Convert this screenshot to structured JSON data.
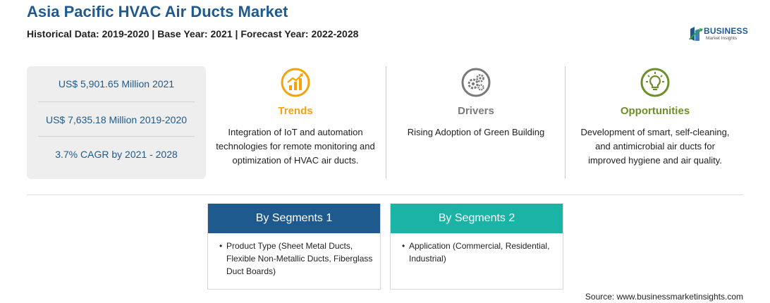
{
  "header": {
    "title": "Asia Pacific HVAC Air Ducts Market",
    "subtitle": "Historical Data: 2019-2020 | Base Year: 2021 | Forecast Year: 2022-2028"
  },
  "logo": {
    "word": "BUSINESS",
    "tagline": "Market Insights"
  },
  "stats": [
    "US$ 5,901.65 Million 2021",
    "US$ 7,635.18 Million 2019-2020",
    "3.7% CAGR by 2021 - 2028"
  ],
  "columns": {
    "trends": {
      "title": "Trends",
      "text": "Integration of IoT and automation technologies for remote monitoring and optimization of HVAC air ducts.",
      "color": "#f5a20d",
      "icon": "chart-growth-icon"
    },
    "drivers": {
      "title": "Drivers",
      "text": "Rising Adoption of Green Building",
      "color": "#7a7a7a",
      "icon": "gears-icon"
    },
    "opportunities": {
      "title": "Opportunities",
      "text": "Development of smart, self-cleaning, and antimicrobial air ducts for improved hygiene and air quality.",
      "color": "#6d8f2a",
      "icon": "lightbulb-icon"
    }
  },
  "segments": [
    {
      "title": "By Segments 1",
      "bullet": "Product Type (Sheet Metal Ducts, Flexible Non-Metallic Ducts, Fiberglass Duct Boards)",
      "color": "#1e5a8e"
    },
    {
      "title": "By Segments 2",
      "bullet": "Application (Commercial, Residential, Industrial)",
      "color": "#1ab3a6"
    }
  ],
  "source": "Source: www.businessmarketinsights.com"
}
